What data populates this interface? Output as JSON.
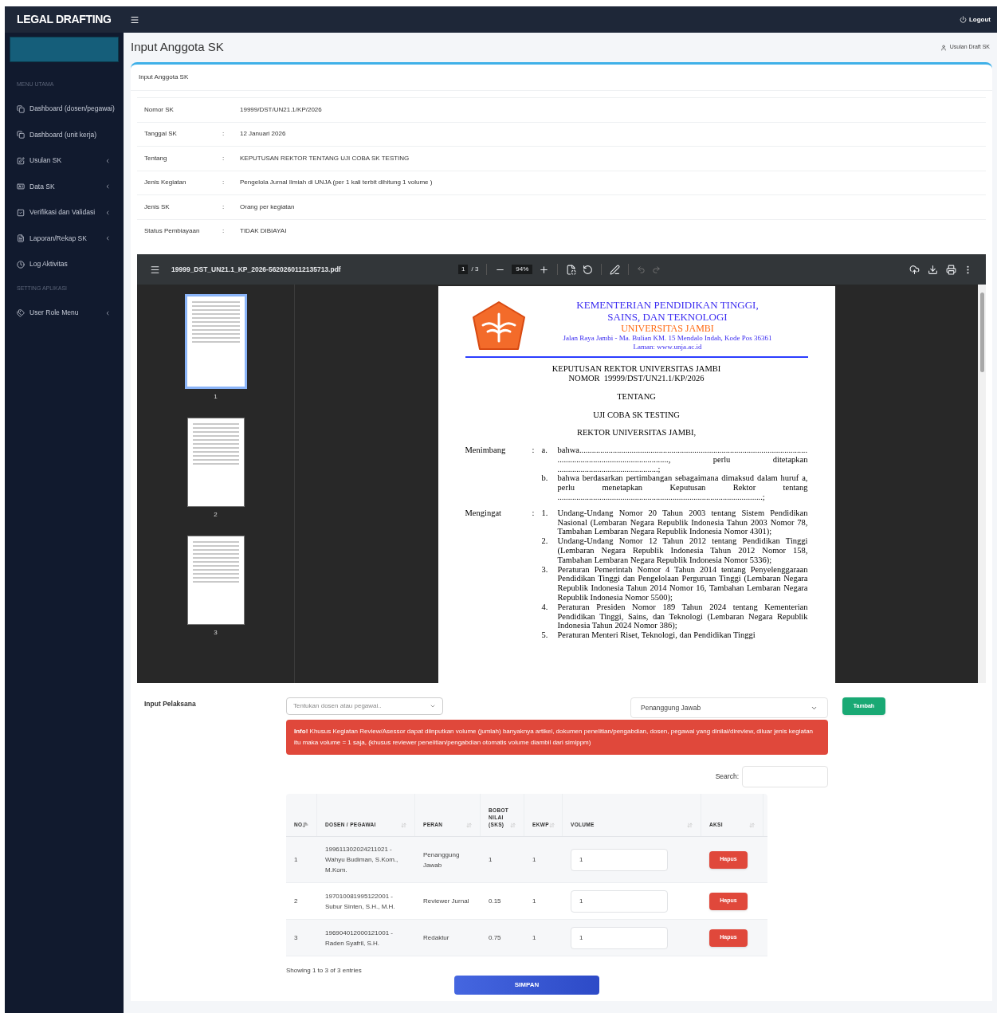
{
  "brand": "LEGAL DRAFTING",
  "header": {
    "logout": "Logout"
  },
  "sidebar": {
    "sections": [
      {
        "heading": "MENU UTAMA",
        "items": [
          {
            "label": "Dashboard (dosen/pegawai)",
            "expandable": false
          },
          {
            "label": "Dashboard (unit kerja)",
            "expandable": false
          },
          {
            "label": "Usulan SK",
            "expandable": true
          },
          {
            "label": "Data SK",
            "expandable": true
          },
          {
            "label": "Verifikasi dan Validasi",
            "expandable": true
          },
          {
            "label": "Laporan/Rekap SK",
            "expandable": true
          },
          {
            "label": "Log Aktivitas",
            "expandable": false
          }
        ]
      },
      {
        "heading": "SETTING APLIKASI",
        "items": [
          {
            "label": "User Role Menu",
            "expandable": true
          }
        ]
      }
    ]
  },
  "page": {
    "title": "Input Anggota SK",
    "breadcrumb": "Usulan Draft SK"
  },
  "card": {
    "title": "Input Anggota SK",
    "info_rows": [
      {
        "label": "Nomor SK",
        "value": "19999/DST/UN21.1/KP/2026"
      },
      {
        "label": "Tanggal SK",
        "separator": ":",
        "value": "12 Januari 2026"
      },
      {
        "label": "Tentang",
        "separator": ":",
        "value": "KEPUTUSAN REKTOR TENTANG UJI COBA SK TESTING"
      },
      {
        "label": "Jenis Kegiatan",
        "separator": ":",
        "value": "Pengelola Jurnal Ilmiah di UNJA (per 1 kali terbit dihitung 1 volume )"
      },
      {
        "label": "Jenis SK",
        "separator": ":",
        "value": "Orang per kegiatan"
      },
      {
        "label": "Status Pembiayaan",
        "separator": ":",
        "value": "TIDAK DIBIAYAI"
      }
    ]
  },
  "pdf_viewer": {
    "filename": "19999_DST_UN21.1_KP_2026-5620260112135713.pdf",
    "page": "1",
    "page_count": "/ 3",
    "zoom": "94%",
    "thumbnails": [
      {
        "label": "1",
        "selected": true
      },
      {
        "label": "2",
        "selected": false
      },
      {
        "label": "3",
        "selected": false
      }
    ],
    "document": {
      "header": [
        "KEMENTERIAN PENDIDIKAN TINGGI,",
        "SAINS, DAN TEKNOLOGI"
      ],
      "university": "UNIVERSITAS JAMBI",
      "address": "Jalan Raya Jambi - Ma. Bulian KM. 15 Mendalo Indah, Kode Pos 36361",
      "website": "Laman: www.unja.ac.id",
      "title_lines": [
        "KEPUTUSAN REKTOR UNIVERSITAS JAMBI",
        "NOMOR  19999/DST/UN21.1/KP/2026"
      ],
      "tentang": "TENTANG",
      "subject": "UJI COBA SK TESTING",
      "authority": "REKTOR UNIVERSITAS JAMBI,",
      "sections": [
        {
          "label": "Menimbang",
          "separator": ":",
          "items": [
            {
              "marker": "a.",
              "text": "bahwa.................................................................................................................................................................., perlu ditetapkan ................................................;"
            },
            {
              "marker": "b.",
              "text": "bahwa berdasarkan pertimbangan sebagaimana dimaksud dalam huruf a, perlu menetapkan Keputusan Rektor tentang ..................................................................................................;"
            }
          ]
        },
        {
          "label": "Mengingat",
          "separator": ":",
          "items": [
            {
              "marker": "1.",
              "text": "Undang-Undang Nomor 20 Tahun 2003 tentang Sistem Pendidikan Nasional (Lembaran Negara Republik Indonesia Tahun 2003 Nomor 78, Tambahan Lembaran Negara Republik Indonesia Nomor 4301);"
            },
            {
              "marker": "2.",
              "text": "Undang-Undang Nomor 12 Tahun 2012 tentang Pendidikan Tinggi (Lembaran Negara Republik Indonesia Tahun 2012 Nomor 158, Tambahan Lembaran Negara Republik Indonesia Nomor 5336);"
            },
            {
              "marker": "3.",
              "text": "Peraturan Pemerintah Nomor 4 Tahun 2014 tentang Penyelenggaraan Pendidikan Tinggi dan Pengelolaan Perguruan Tinggi (Lembaran Negara Republik Indonesia Tahun 2014 Nomor 16, Tambahan Lembaran Negara Republik Indonesia Nomor 5500);"
            },
            {
              "marker": "4.",
              "text": "Peraturan Presiden Nomor 189 Tahun 2024 tentang Kementerian Pendidikan Tinggi, Sains, dan Teknologi (Lembaran Negara Republik Indonesia Tahun 2024 Nomor 386);"
            },
            {
              "marker": "5.",
              "text": "Peraturan Menteri Riset, Teknologi, dan Pendidikan Tinggi"
            }
          ]
        }
      ]
    }
  },
  "pelaksana": {
    "label": "Input Pelaksana",
    "person_select": {
      "placeholder": "Tentukan dosen atau pegawai.."
    },
    "role_select": {
      "value": "Penanggung Jawab"
    },
    "add_button": "Tambah",
    "alert": "**Info!** Khusus Kegiatan Review/Asessor dapat diinputkan volume (jumlah) banyaknya artikel, dokumen penelitian/pengabdian, dosen, pegawai yang dinilai/direview, diluar jenis kegiatan itu maka volume = 1 saja, (khusus reviewer penelitian/pengabdian otomatis volume diambil dari simlppm)",
    "search_label": "Search:",
    "table": {
      "columns": [
        {
          "label": "NO",
          "sorted": true
        },
        {
          "label": "DOSEN / PEGAWAI",
          "sorted": false
        },
        {
          "label": "PERAN",
          "sorted": false
        },
        {
          "label": "BOBOT NILAI (SKS)",
          "sorted": false
        },
        {
          "label": "EKWP",
          "sorted": false
        },
        {
          "label": "VOLUME",
          "sorted": false
        },
        {
          "label": "AKSI",
          "sorted": false
        }
      ],
      "rows": [
        {
          "no": "1",
          "dosen": "199611302024211021 - Wahyu Budiman, S.Kom., M.Kom.",
          "peran": "Penanggung Jawab",
          "bobot": "1",
          "ekwp": "1",
          "volume": "1",
          "action": "Hapus"
        },
        {
          "no": "2",
          "dosen": "197010081995122001 - Subur Sinten, S.H., M.H.",
          "peran": "Reviewer Jurnal",
          "bobot": "0.15",
          "ekwp": "1",
          "volume": "1",
          "action": "Hapus"
        },
        {
          "no": "3",
          "dosen": "196904012000121001 - Raden Syafril, S.H.",
          "peran": "Redaktur",
          "bobot": "0.75",
          "ekwp": "1",
          "volume": "1",
          "action": "Hapus"
        }
      ]
    },
    "footer": "Showing 1 to 3 of 3 entries",
    "submit": "SIMPAN"
  }
}
